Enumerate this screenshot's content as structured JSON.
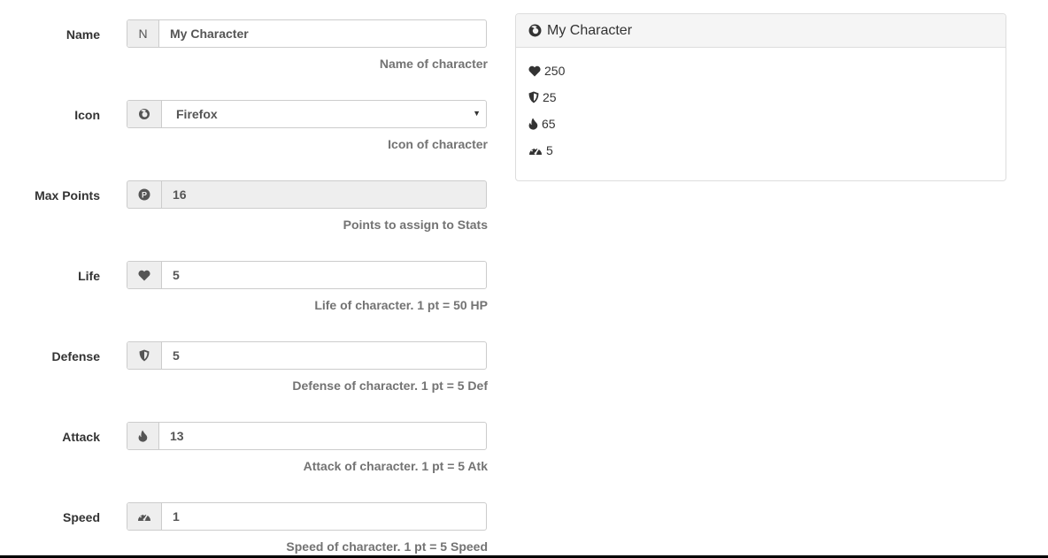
{
  "form": {
    "name": {
      "label": "Name",
      "addon": "N",
      "value": "My Character",
      "help": "Name of character"
    },
    "icon": {
      "label": "Icon",
      "addon_icon": "firefox-icon",
      "value": "Firefox",
      "help": "Icon of character"
    },
    "max_points": {
      "label": "Max Points",
      "addon_icon": "points-icon",
      "value": "16",
      "help": "Points to assign to Stats"
    },
    "life": {
      "label": "Life",
      "addon_icon": "heart-icon",
      "value": "5",
      "help": "Life of character. 1 pt = 50 HP"
    },
    "defense": {
      "label": "Defense",
      "addon_icon": "shield-icon",
      "value": "5",
      "help": "Defense of character. 1 pt = 5 Def"
    },
    "attack": {
      "label": "Attack",
      "addon_icon": "fire-icon",
      "value": "13",
      "help": "Attack of character. 1 pt = 5 Atk"
    },
    "speed": {
      "label": "Speed",
      "addon_icon": "speedometer-icon",
      "value": "1",
      "help": "Speed of character. 1 pt = 5 Speed"
    }
  },
  "preview": {
    "title": "My Character",
    "title_icon": "firefox-icon",
    "stats": [
      {
        "icon": "heart-icon",
        "value": "250"
      },
      {
        "icon": "shield-icon",
        "value": "25"
      },
      {
        "icon": "fire-icon",
        "value": "65"
      },
      {
        "icon": "speedometer-icon",
        "value": "5"
      }
    ]
  }
}
